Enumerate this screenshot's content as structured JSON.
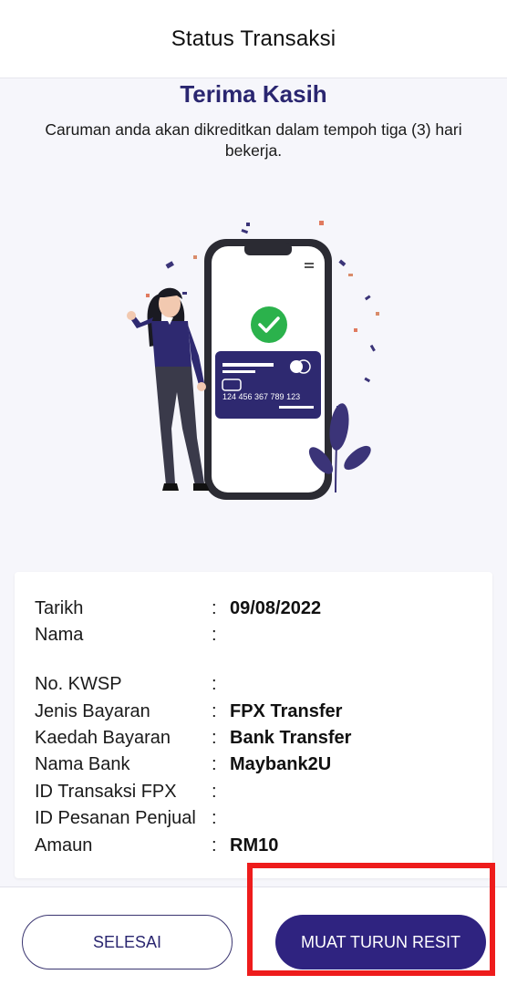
{
  "header": {
    "title": "Status Transaksi"
  },
  "hero": {
    "title": "Terima Kasih",
    "subtitle": "Caruman anda akan dikreditkan dalam tempoh tiga (3) hari bekerja.",
    "card_number": "124 456 367 789 123"
  },
  "details": [
    {
      "label": "Tarikh",
      "value": "09/08/2022"
    },
    {
      "label": "Nama",
      "value": ""
    },
    {
      "label": "No. KWSP",
      "value": ""
    },
    {
      "label": "Jenis Bayaran",
      "value": "FPX Transfer"
    },
    {
      "label": "Kaedah Bayaran",
      "value": "Bank Transfer"
    },
    {
      "label": "Nama Bank",
      "value": "Maybank2U"
    },
    {
      "label": "ID Transaksi FPX",
      "value": ""
    },
    {
      "label": "ID Pesanan Penjual",
      "value": ""
    },
    {
      "label": "Amaun",
      "value": "RM10"
    }
  ],
  "footer": {
    "done_label": "SELESAI",
    "download_label": "MUAT TURUN RESIT"
  },
  "colors": {
    "brand": "#2f2380",
    "title": "#2a2670",
    "highlight": "#ee1c1c",
    "success": "#2bb24c"
  }
}
